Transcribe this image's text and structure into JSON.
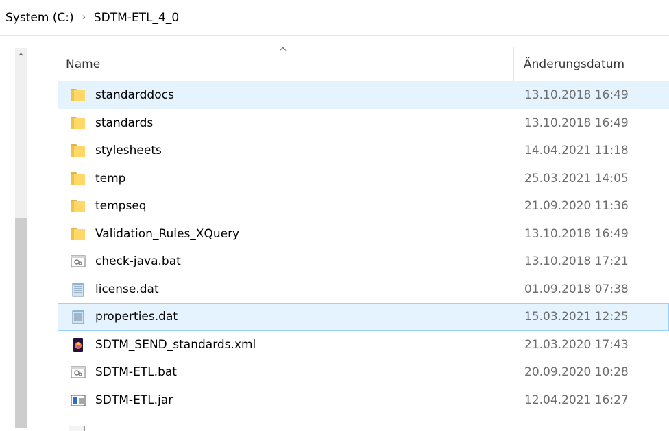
{
  "breadcrumb": {
    "root": "System (C:)",
    "separator": "›",
    "current": "SDTM-ETL_4_0"
  },
  "scrollbar": {
    "up_glyph": "^"
  },
  "header": {
    "name_label": "Name",
    "sort_glyph": "^",
    "date_label": "Änderungsdatum"
  },
  "files": [
    {
      "name": "standarddocs",
      "date": "13.10.2018 16:49",
      "icon": "folder-icon"
    },
    {
      "name": "standards",
      "date": "13.10.2018 16:49",
      "icon": "folder-icon"
    },
    {
      "name": "stylesheets",
      "date": "14.04.2021 11:18",
      "icon": "folder-icon"
    },
    {
      "name": "temp",
      "date": "25.03.2021 14:05",
      "icon": "folder-icon"
    },
    {
      "name": "tempseq",
      "date": "21.09.2020 11:36",
      "icon": "folder-icon"
    },
    {
      "name": "Validation_Rules_XQuery",
      "date": "13.10.2018 16:49",
      "icon": "folder-icon"
    },
    {
      "name": "check-java.bat",
      "date": "13.10.2018 17:21",
      "icon": "batch-file-icon"
    },
    {
      "name": "license.dat",
      "date": "01.09.2018 07:38",
      "icon": "notepad-file-icon"
    },
    {
      "name": "properties.dat",
      "date": "15.03.2021 12:25",
      "icon": "notepad-file-icon"
    },
    {
      "name": "SDTM_SEND_standards.xml",
      "date": "21.03.2020 17:43",
      "icon": "firefox-file-icon"
    },
    {
      "name": "SDTM-ETL.bat",
      "date": "20.09.2020 10:28",
      "icon": "batch-file-icon"
    },
    {
      "name": "SDTM-ETL.jar",
      "date": "12.04.2021 16:27",
      "icon": "jar-file-icon"
    }
  ]
}
